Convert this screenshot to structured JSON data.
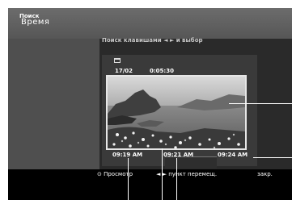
{
  "header": {
    "title": "Время"
  },
  "sidebar": {
    "items": [
      {
        "label": "Поиск"
      }
    ]
  },
  "main": {
    "hint": "Поиск клавишами ◄ ► и выбор",
    "date": "17/02",
    "time": "0:05:30",
    "thumb_times": [
      "09:19 AM",
      "09:21 AM",
      "09:24 AM"
    ]
  },
  "footer": {
    "items": [
      {
        "label": "⊙ Просмотр"
      },
      {
        "label": "◄ ► пункт перемещ."
      },
      {
        "label": "закр."
      }
    ]
  }
}
